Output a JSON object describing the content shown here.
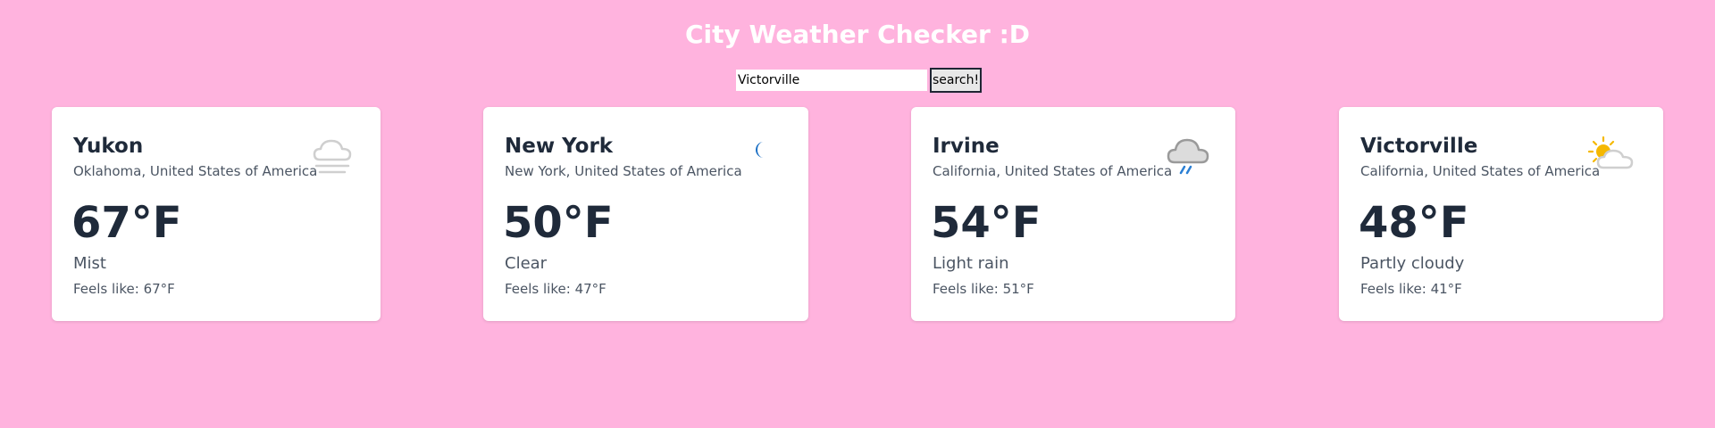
{
  "header": {
    "title": "City Weather Checker :D"
  },
  "search": {
    "value": "Victorville",
    "button_label": "search!"
  },
  "feels_label": "Feels like: ",
  "cards": [
    {
      "city": "Yukon",
      "region": "Oklahoma, United States of America",
      "temp": "67°F",
      "condition": "Mist",
      "feels_like": "67°F",
      "icon": "mist-icon"
    },
    {
      "city": "New York",
      "region": "New York, United States of America",
      "temp": "50°F",
      "condition": "Clear",
      "feels_like": "47°F",
      "icon": "moon-icon"
    },
    {
      "city": "Irvine",
      "region": "California, United States of America",
      "temp": "54°F",
      "condition": "Light rain",
      "feels_like": "51°F",
      "icon": "rain-cloud-icon"
    },
    {
      "city": "Victorville",
      "region": "California, United States of America",
      "temp": "48°F",
      "condition": "Partly cloudy",
      "feels_like": "41°F",
      "icon": "partly-cloudy-icon"
    }
  ],
  "colors": {
    "background": "#ffb3de",
    "card": "#ffffff",
    "text_dark": "#1f2a3a",
    "text_muted": "#4b5563",
    "moon": "#1a6fc4",
    "rain": "#2a7fd4",
    "sun": "#f5b800"
  }
}
